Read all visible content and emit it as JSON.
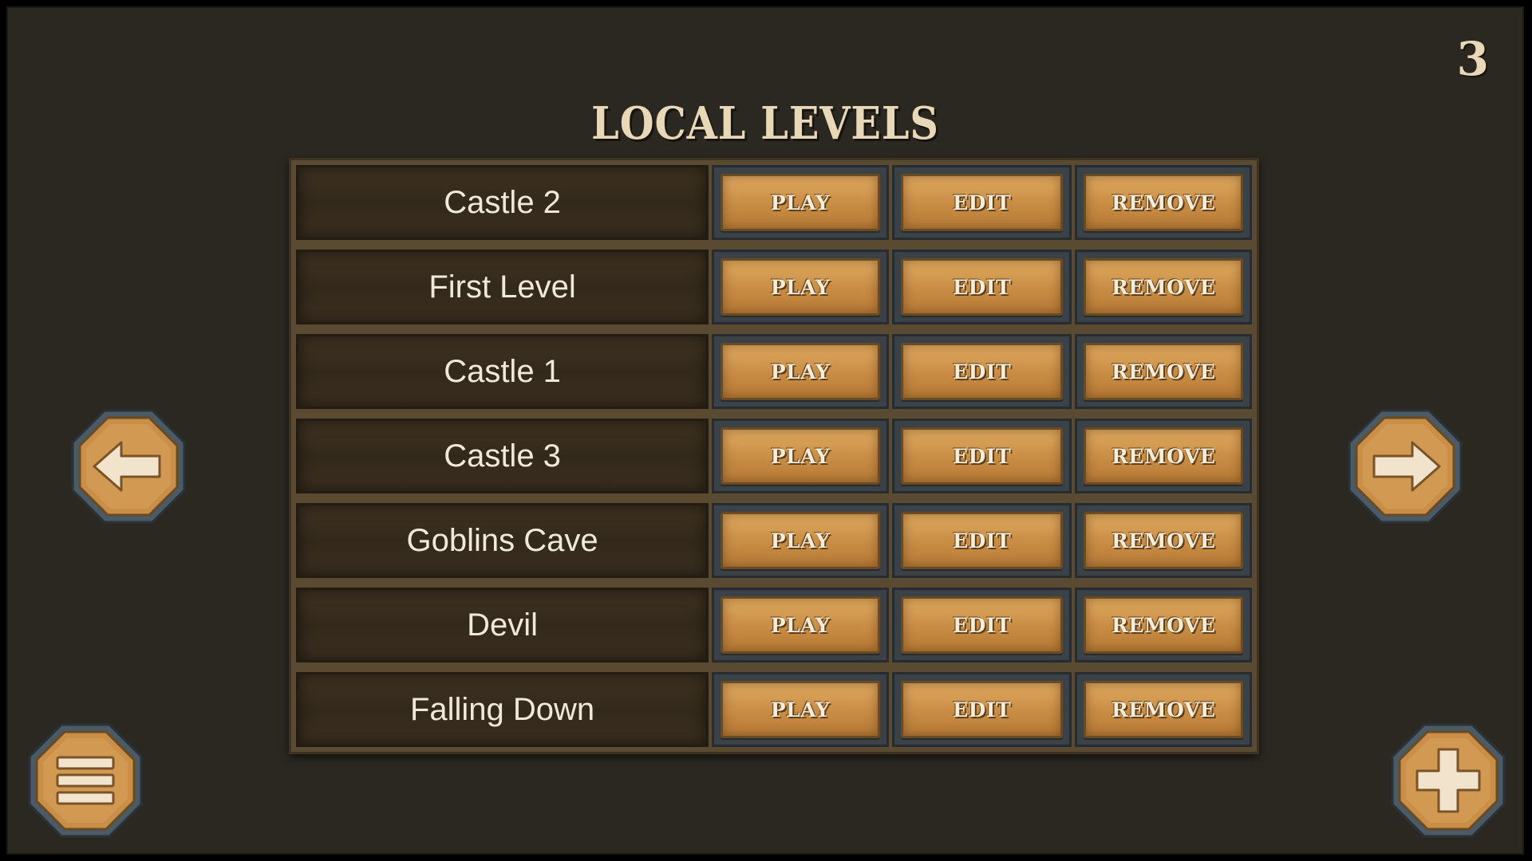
{
  "page": {
    "number": "3",
    "title": "LOCAL LEVELS"
  },
  "levels": [
    {
      "name": "Castle 2",
      "play": "PLAY",
      "edit": "EDIT",
      "remove": "REMOVE"
    },
    {
      "name": "First Level",
      "play": "PLAY",
      "edit": "EDIT",
      "remove": "REMOVE"
    },
    {
      "name": "Castle 1",
      "play": "PLAY",
      "edit": "EDIT",
      "remove": "REMOVE"
    },
    {
      "name": "Castle 3",
      "play": "PLAY",
      "edit": "EDIT",
      "remove": "REMOVE"
    },
    {
      "name": "Goblins Cave",
      "play": "PLAY",
      "edit": "EDIT",
      "remove": "REMOVE"
    },
    {
      "name": "Devil",
      "play": "PLAY",
      "edit": "EDIT",
      "remove": "REMOVE"
    },
    {
      "name": "Falling Down",
      "play": "PLAY",
      "edit": "EDIT",
      "remove": "REMOVE"
    }
  ],
  "controls": {
    "prev_icon": "arrow-left-icon",
    "next_icon": "arrow-right-icon",
    "menu_icon": "hamburger-menu-icon",
    "add_icon": "plus-icon"
  },
  "colors": {
    "background": "#2a2820",
    "button_gold": "#c88c44",
    "text_light": "#f0e8da"
  }
}
